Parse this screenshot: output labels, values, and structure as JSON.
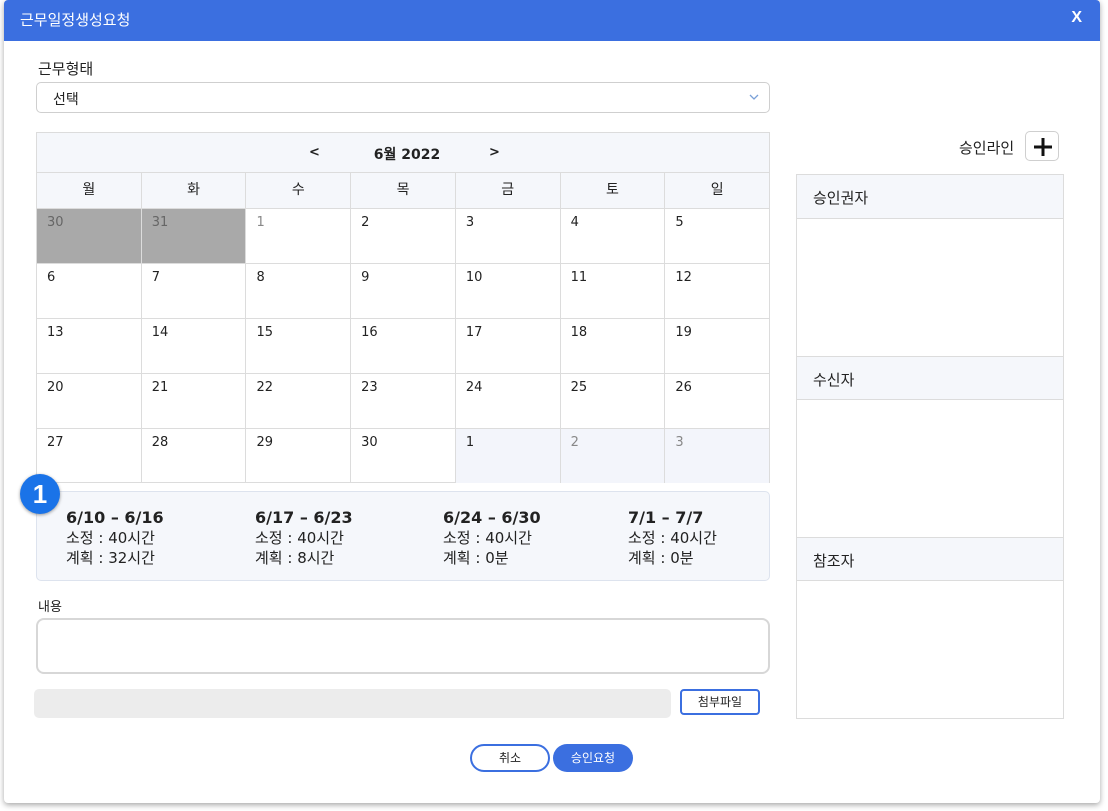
{
  "window": {
    "title": "근무일정생성요청",
    "close_label": "X"
  },
  "form": {
    "work_type_label": "근무형태",
    "work_type_value": "선택",
    "content_label": "내용",
    "attach_label": "첨부파일"
  },
  "calendar": {
    "prev": "<",
    "next": ">",
    "month_label": "6월 2022",
    "weekdays": [
      "월",
      "화",
      "수",
      "목",
      "금",
      "토",
      "일"
    ],
    "weeks": [
      [
        "30",
        "31",
        "1",
        "2",
        "3",
        "4",
        "5"
      ],
      [
        "6",
        "7",
        "8",
        "9",
        "10",
        "11",
        "12"
      ],
      [
        "13",
        "14",
        "15",
        "16",
        "17",
        "18",
        "19"
      ],
      [
        "20",
        "21",
        "22",
        "23",
        "24",
        "25",
        "26"
      ],
      [
        "27",
        "28",
        "29",
        "30",
        "1",
        "2",
        "3"
      ]
    ]
  },
  "badge": "1",
  "summary": [
    {
      "range": "6/10 – 6/16",
      "fixed": "소정 : 40시간",
      "plan": "계획 : 32시간"
    },
    {
      "range": "6/17 – 6/23",
      "fixed": "소정 : 40시간",
      "plan": "계획 : 8시간"
    },
    {
      "range": "6/24 – 6/30",
      "fixed": "소정 : 40시간",
      "plan": "계획 : 0분"
    },
    {
      "range": "7/1 – 7/7",
      "fixed": "소정 : 40시간",
      "plan": "계획 : 0분"
    }
  ],
  "approval": {
    "line_label": "승인라인",
    "approver_label": "승인권자",
    "receiver_label": "수신자",
    "reference_label": "참조자"
  },
  "footer": {
    "cancel": "취소",
    "submit": "승인요청"
  },
  "colors": {
    "accent": "#3b6fe0",
    "badge": "#1a73e8",
    "prev_month_cell": "#a9a9a9"
  }
}
